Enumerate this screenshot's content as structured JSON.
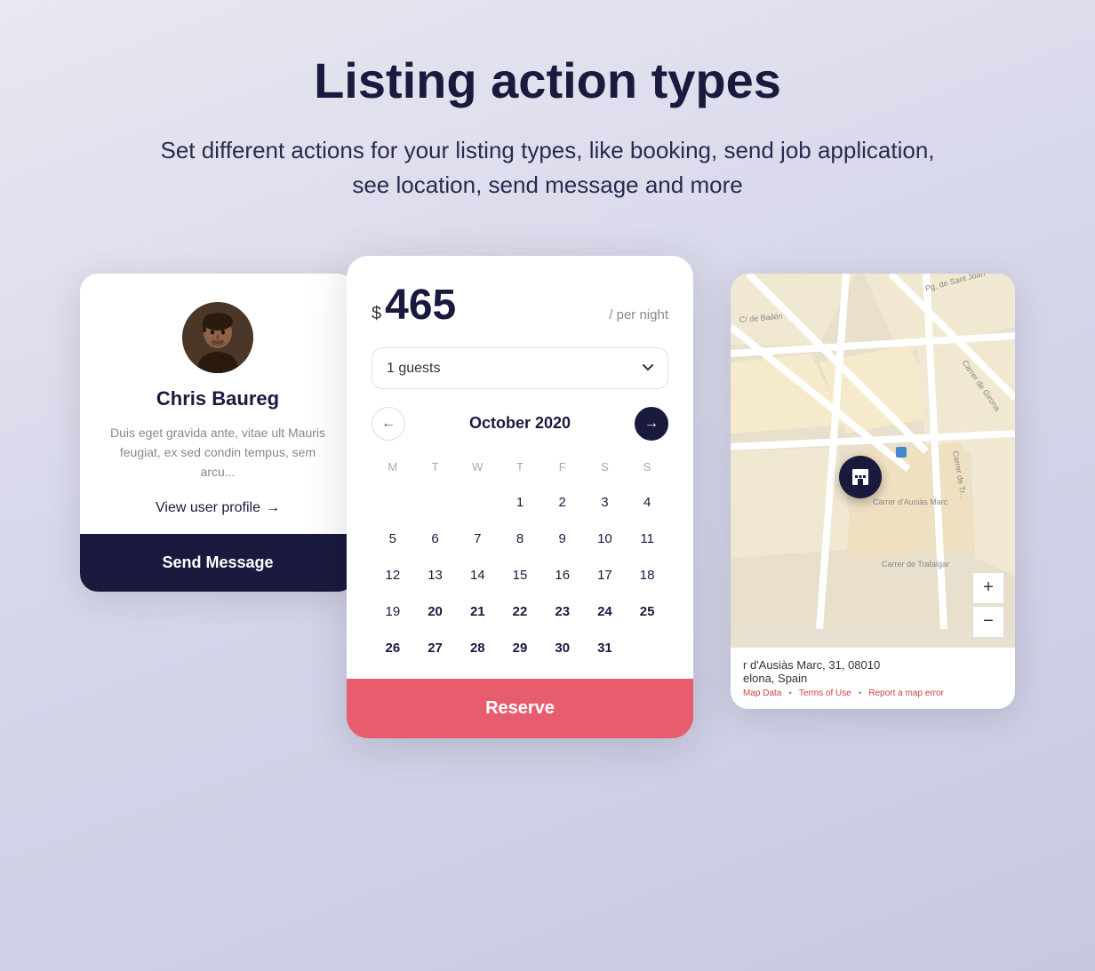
{
  "page": {
    "title": "Listing action types",
    "subtitle": "Set different actions for your listing types, like booking, send job application, see location, send message and more"
  },
  "profile_card": {
    "name": "Chris Baureg",
    "bio": "Duis eget gravida ante, vitae ult Mauris feugiat, ex sed condin tempus, sem arcu...",
    "view_profile_label": "View user profile",
    "send_message_label": "Send Message",
    "arrow": "→"
  },
  "booking_card": {
    "currency": "$",
    "price": "465",
    "period": "/ per night",
    "guests_value": "1 guests",
    "calendar": {
      "month_year": "October 2020",
      "days_header": [
        "M",
        "T",
        "W",
        "T",
        "F",
        "S",
        "S"
      ],
      "weeks": [
        [
          "",
          "",
          "",
          "1",
          "2",
          "3",
          "4"
        ],
        [
          "5",
          "6",
          "7",
          "8",
          "9",
          "10",
          "11"
        ],
        [
          "12",
          "13",
          "14",
          "15",
          "16",
          "17",
          "18"
        ],
        [
          "19",
          "20",
          "21",
          "22",
          "23",
          "24",
          "25"
        ],
        [
          "26",
          "27",
          "28",
          "29",
          "30",
          "31",
          ""
        ]
      ]
    },
    "reserve_label": "Reserve"
  },
  "map_card": {
    "address_line1": "r d'Ausiàs Marc, 31, 08010",
    "address_line2": "elona, Spain",
    "map_data_label": "Map Data",
    "terms_label": "Terms of Use",
    "report_label": "Report a map error",
    "zoom_in": "+",
    "zoom_out": "−",
    "pin_icon": "🏢"
  }
}
